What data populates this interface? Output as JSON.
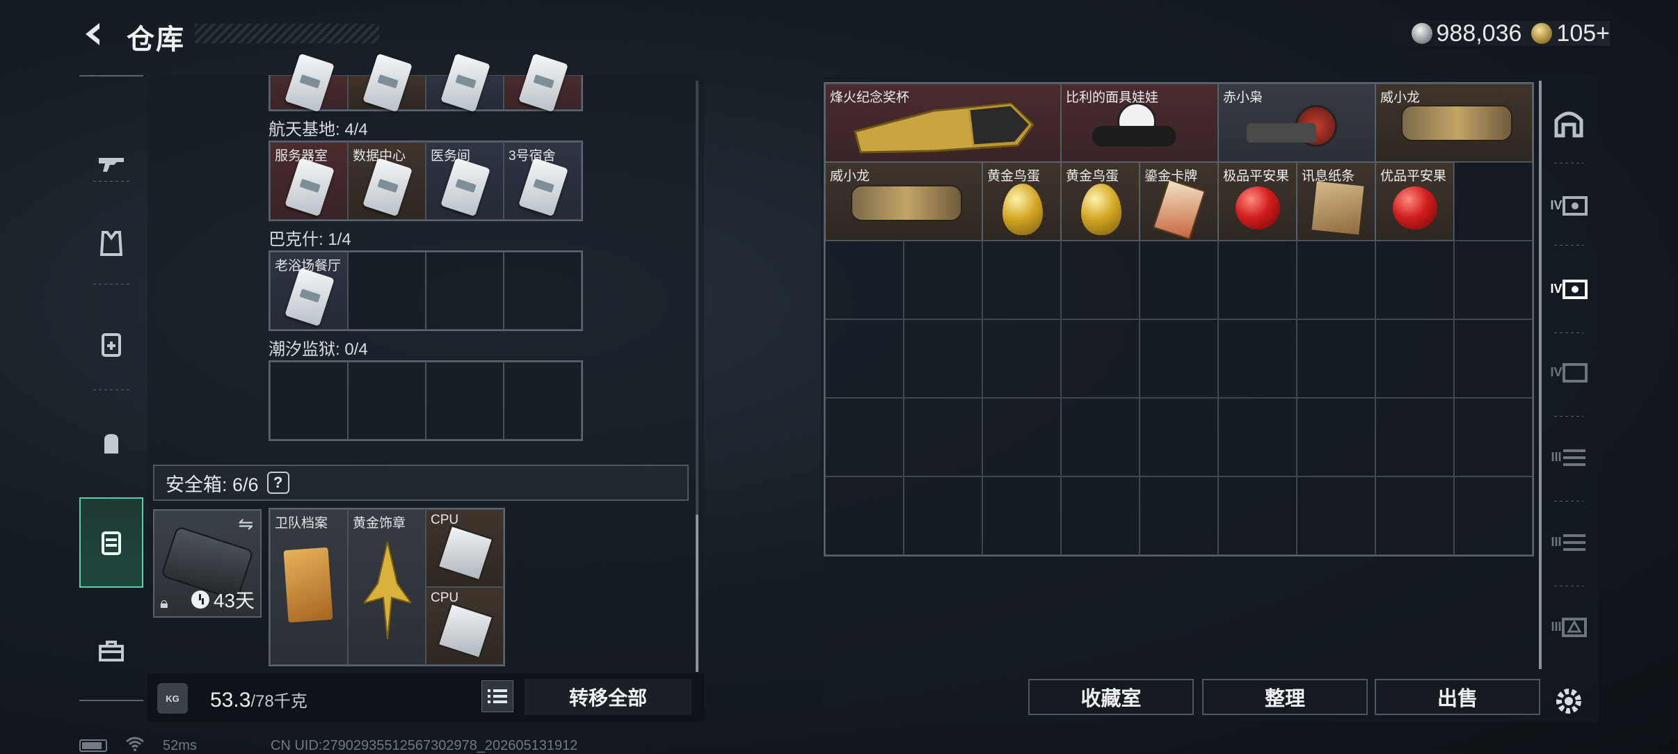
{
  "header": {
    "title": "仓库",
    "back_icon": "chevron-left-icon",
    "currency": [
      {
        "icon": "silver-coin-icon",
        "value": "988,036"
      },
      {
        "icon": "gold-coin-icon",
        "value": "105+"
      }
    ]
  },
  "left_nav": [
    {
      "name": "weapons",
      "icon": "gun-icon"
    },
    {
      "name": "armor",
      "icon": "vest-icon"
    },
    {
      "name": "chest-rig",
      "icon": "rig-icon"
    },
    {
      "name": "backpack",
      "icon": "backpack-icon"
    },
    {
      "name": "safe-box",
      "icon": "case-icon",
      "active": true
    },
    {
      "name": "toolbox",
      "icon": "toolbox-icon"
    }
  ],
  "keycards": {
    "groups": [
      {
        "label": "航天基地: 4/4",
        "items": [
          "服务器室",
          "数据中心",
          "医务间",
          "3号宿舍"
        ]
      },
      {
        "label": "巴克什: 1/4",
        "items": [
          "老浴场餐厅",
          "",
          "",
          ""
        ]
      },
      {
        "label": "潮汐监狱: 0/4",
        "items": [
          "",
          "",
          "",
          ""
        ]
      }
    ]
  },
  "safe_box": {
    "label": "安全箱: 6/6",
    "help": "?",
    "days": "43天",
    "items": [
      "卫队档案",
      "黄金饰章",
      "CPU",
      "CPU"
    ]
  },
  "weight": {
    "current": "53.3",
    "max": "/78千克",
    "icon_text": "KG"
  },
  "transfer_all": "转移全部",
  "stash_items": [
    "烽火纪念奖杯",
    "比利的面具娃娃",
    "赤小枭",
    "威小龙",
    "威小龙",
    "黄金鸟蛋",
    "黄金鸟蛋",
    "鎏金卡牌",
    "极品平安果",
    "讯息纸条",
    "优品平安果"
  ],
  "actions": [
    "收藏室",
    "整理",
    "出售"
  ],
  "categories": [
    "IV",
    "IV",
    "IV",
    "III",
    "III",
    "III"
  ],
  "footer": {
    "ping": "52ms",
    "uid": "CN UID:27902935512567302978_202605131912"
  },
  "colors": {
    "accent": "#5dd0a6",
    "red_rarity": "#4a2b2e",
    "gold_rarity": "#3e342c",
    "blue_rarity": "#2e3442"
  }
}
